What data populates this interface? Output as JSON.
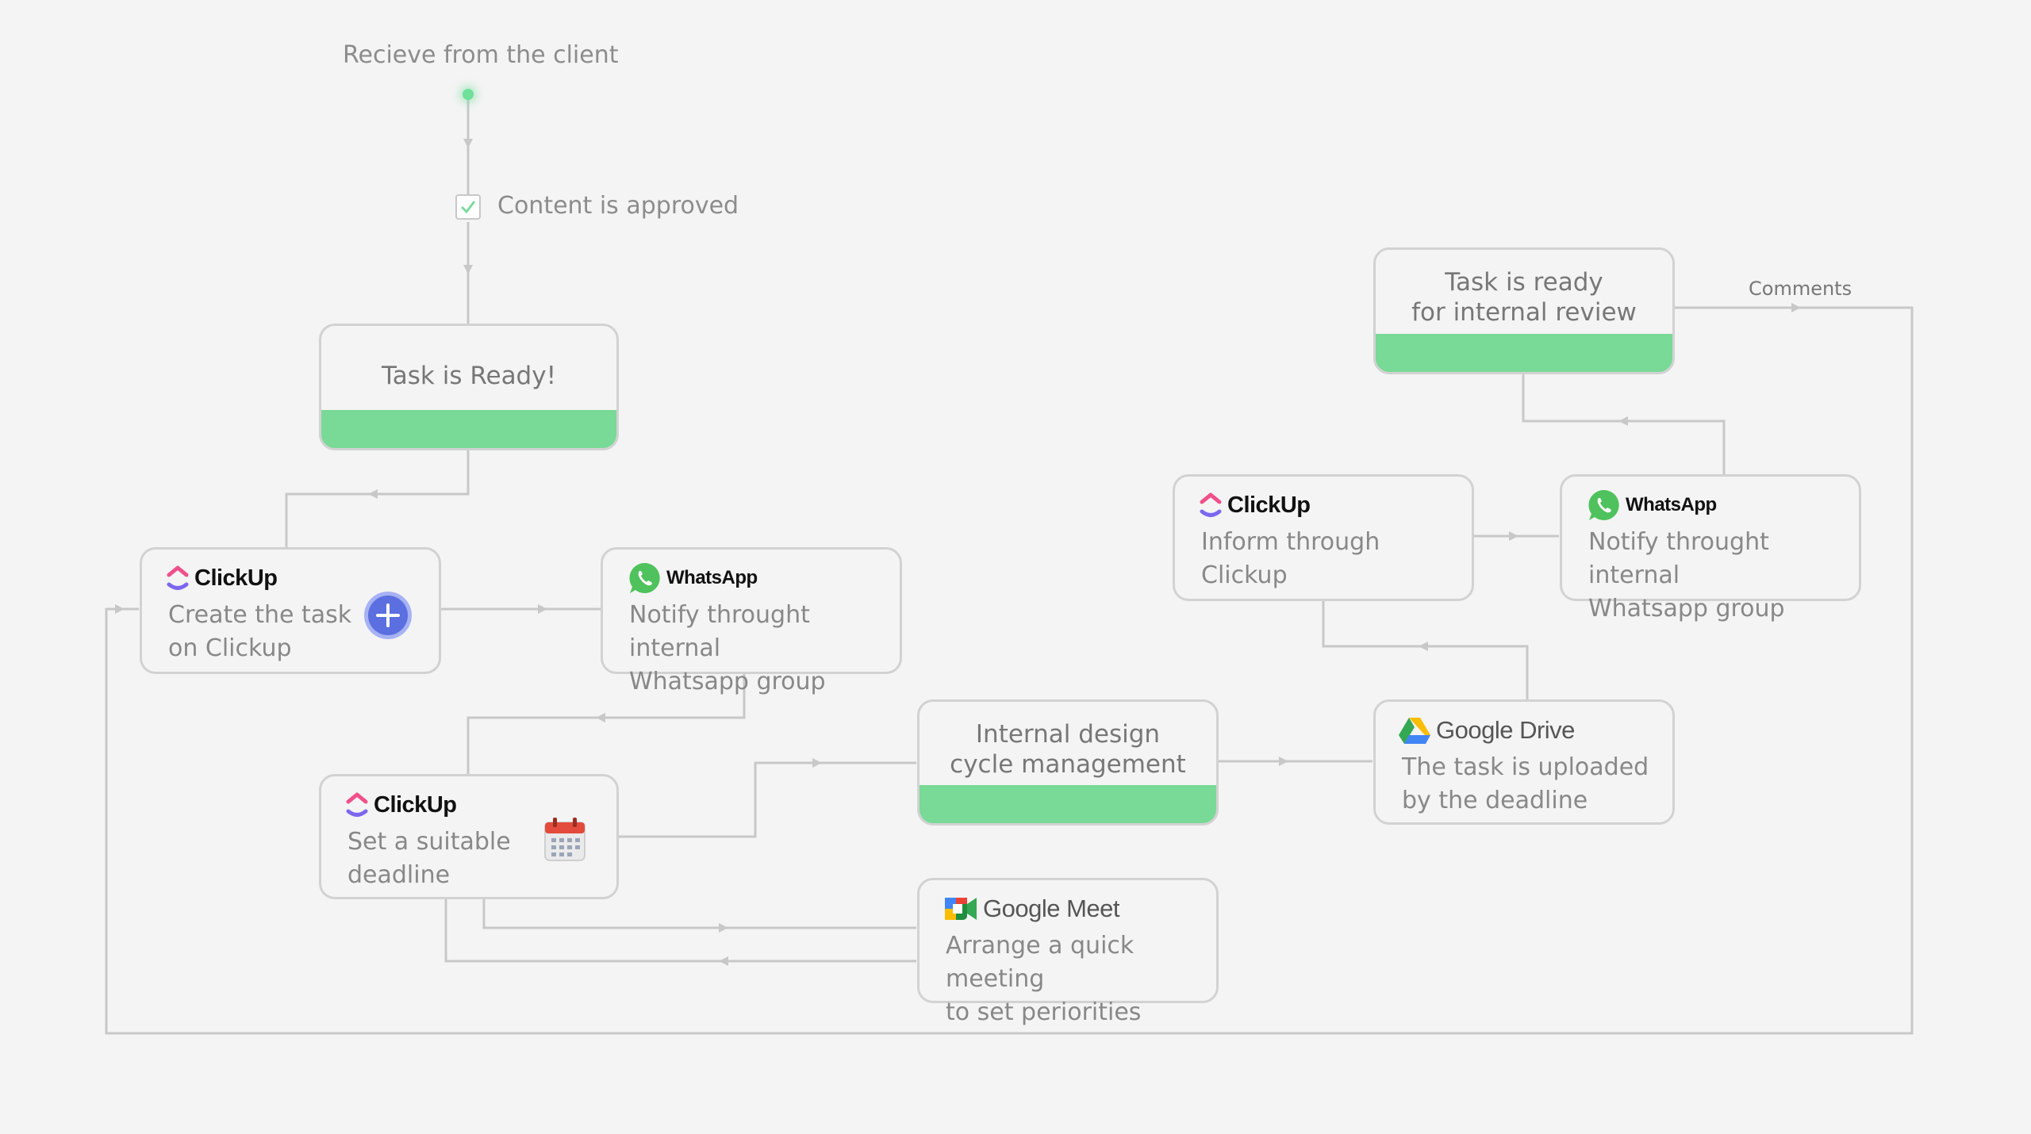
{
  "labels": {
    "start": "Recieve from the client",
    "approved": "Content is approved",
    "comments": "Comments"
  },
  "status_nodes": {
    "task_ready": "Task is Ready!",
    "internal_review": "Task is ready\nfor internal review",
    "design_cycle": "Internal design\ncycle management"
  },
  "cards": {
    "create_task": {
      "brand": "ClickUp",
      "text": "Create the task\non Clickup"
    },
    "notify_whatsapp_1": {
      "brand": "WhatsApp",
      "text": "Notify throught internal\nWhatsapp group"
    },
    "set_deadline": {
      "brand": "ClickUp",
      "text": "Set a suitable\ndeadline"
    },
    "quick_meeting": {
      "brand": "Google Meet",
      "text": "Arrange a quick meeting\nto set periorities"
    },
    "upload_drive": {
      "brand": "Google Drive",
      "text": "The task is uploaded\nby the deadline"
    },
    "inform_clickup": {
      "brand": "ClickUp",
      "text": "Inform through\nClickup"
    },
    "notify_whatsapp_2": {
      "brand": "WhatsApp",
      "text": "Notify throught internal\nWhatsapp group"
    }
  },
  "colors": {
    "background": "#f4f4f4",
    "status_bar": "#79d996",
    "start_dot": "#6fe09a",
    "connector": "#c8c8c8",
    "plus_button": "#5b6fe0"
  },
  "icons": {
    "clickup": "clickup-logo-icon",
    "whatsapp": "whatsapp-logo-icon",
    "google_drive": "google-drive-logo-icon",
    "google_meet": "google-meet-logo-icon",
    "plus": "plus-circle-icon",
    "calendar": "calendar-icon",
    "check": "checkbox-icon"
  }
}
